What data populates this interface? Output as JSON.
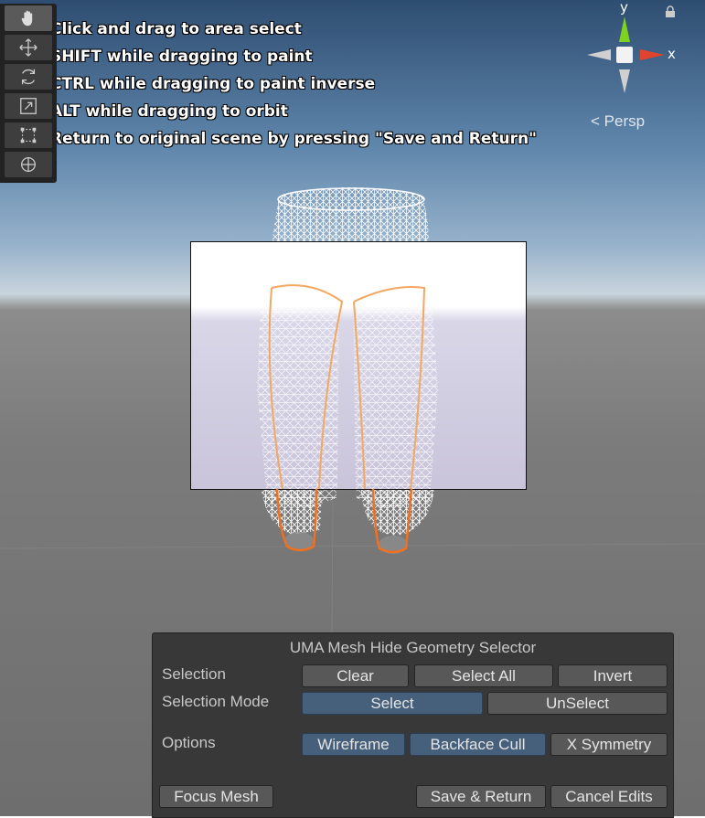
{
  "hints": [
    "Click and drag to area select",
    "SHIFT while dragging to paint",
    "CTRL while dragging to paint inverse",
    "ALT while dragging to orbit",
    "Return to original scene by pressing \"Save and Return\""
  ],
  "toolbar": {
    "tools": [
      "hand-tool",
      "move-tool",
      "rotate-tool",
      "scale-tool",
      "rect-tool",
      "transform-tool"
    ]
  },
  "gizmo": {
    "y_label": "y",
    "x_label": "x",
    "persp_label": "< Persp",
    "colors": {
      "y": "#7ed321",
      "x": "#e0442f",
      "neutral": "#d0d0d0"
    }
  },
  "panel": {
    "title": "UMA Mesh Hide Geometry Selector",
    "selection_label": "Selection",
    "selection_buttons": {
      "clear": "Clear",
      "select_all": "Select All",
      "invert": "Invert"
    },
    "mode_label": "Selection Mode",
    "mode_buttons": {
      "select": "Select",
      "unselect": "UnSelect"
    },
    "options_label": "Options",
    "option_buttons": {
      "wireframe": "Wireframe",
      "backface_cull": "Backface Cull",
      "x_symmetry": "X Symmetry"
    },
    "footer_buttons": {
      "focus_mesh": "Focus Mesh",
      "save_return": "Save & Return",
      "cancel_edits": "Cancel Edits"
    },
    "active_color": "#46607c"
  }
}
